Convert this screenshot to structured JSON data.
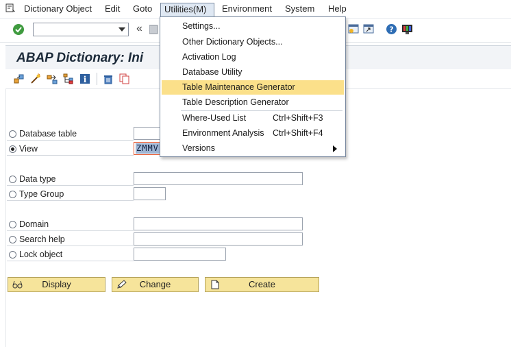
{
  "menubar": {
    "items": [
      "Dictionary Object",
      "Edit",
      "Goto",
      "Utilities(M)",
      "Environment",
      "System",
      "Help"
    ]
  },
  "toolbar": {
    "command_value": "",
    "back_glyph": "«"
  },
  "title": "ABAP Dictionary: Ini",
  "form": {
    "rows": [
      {
        "label": "Database table",
        "selected": false,
        "value": ""
      },
      {
        "label": "View",
        "selected": true,
        "value": "ZMMV"
      },
      {
        "label": "Data type",
        "selected": false,
        "value": ""
      },
      {
        "label": "Type Group",
        "selected": false,
        "value": ""
      },
      {
        "label": "Domain",
        "selected": false,
        "value": ""
      },
      {
        "label": "Search help",
        "selected": false,
        "value": ""
      },
      {
        "label": "Lock object",
        "selected": false,
        "value": ""
      }
    ]
  },
  "buttons": {
    "display": "Display",
    "change": "Change",
    "create": "Create"
  },
  "dropdown": {
    "items": [
      {
        "label": "Settings...",
        "shortcut": ""
      },
      {
        "label": "Other Dictionary Objects...",
        "shortcut": ""
      },
      {
        "label": "Activation Log",
        "shortcut": ""
      },
      {
        "label": "Database Utility",
        "shortcut": ""
      },
      {
        "label": "Table Maintenance Generator",
        "shortcut": "",
        "highlighted": true
      },
      {
        "label": "Table Description Generator",
        "shortcut": ""
      },
      {
        "label": "Where-Used List",
        "shortcut": "Ctrl+Shift+F3"
      },
      {
        "label": "Environment Analysis",
        "shortcut": "Ctrl+Shift+F4"
      },
      {
        "label": "Versions",
        "shortcut": "",
        "submenu": true
      }
    ]
  },
  "colors": {
    "button_bg": "#f6e49b",
    "highlight": "#fbe08a",
    "selection": "#9fb5d3"
  }
}
